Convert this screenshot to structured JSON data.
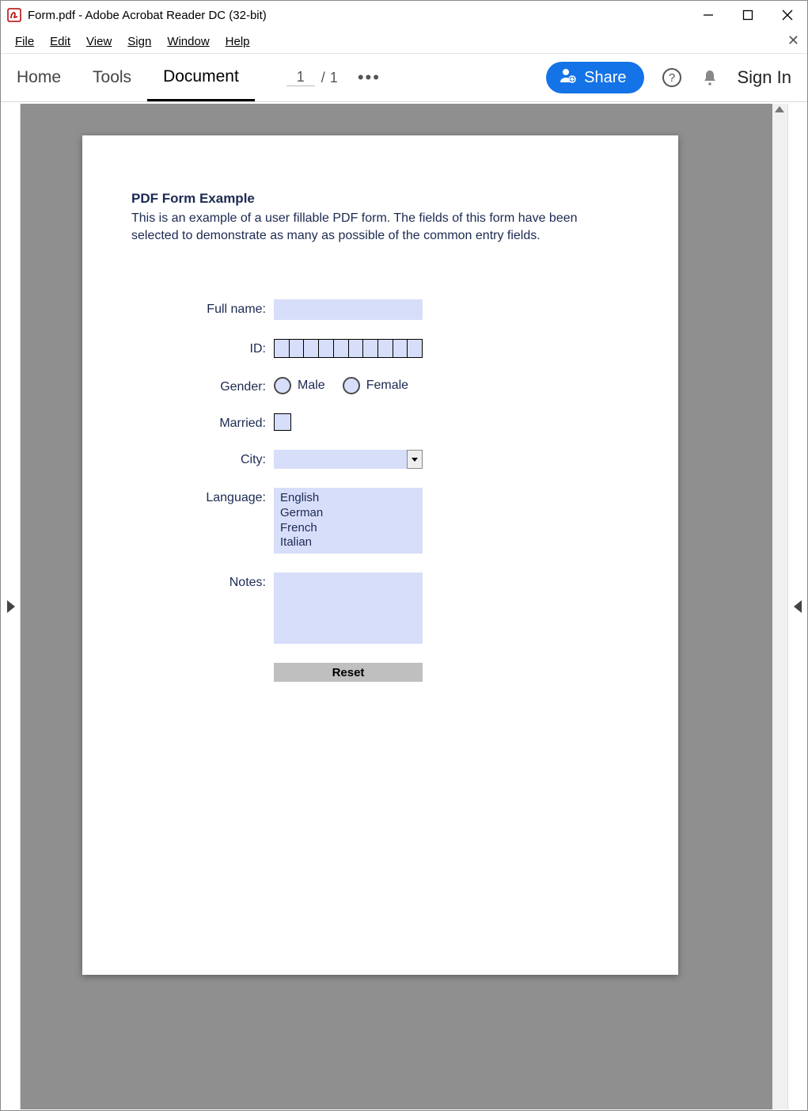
{
  "window": {
    "title": "Form.pdf - Adobe Acrobat Reader DC (32-bit)"
  },
  "menu": {
    "file": "File",
    "edit": "Edit",
    "view": "View",
    "sign": "Sign",
    "window": "Window",
    "help": "Help"
  },
  "toolbar": {
    "home": "Home",
    "tools": "Tools",
    "document": "Document",
    "page_current": "1",
    "page_sep": "/",
    "page_total": "1",
    "share": "Share",
    "signin": "Sign In"
  },
  "form": {
    "title": "PDF Form Example",
    "description": "This is an example of a user fillable PDF form. The fields of this form have been selected to demonstrate as many as possible of the common entry fields.",
    "labels": {
      "full_name": "Full name:",
      "id": "ID:",
      "gender": "Gender:",
      "married": "Married:",
      "city": "City:",
      "language": "Language:",
      "notes": "Notes:"
    },
    "gender_options": {
      "male": "Male",
      "female": "Female"
    },
    "language_options": [
      "English",
      "German",
      "French",
      "Italian"
    ],
    "reset": "Reset"
  }
}
